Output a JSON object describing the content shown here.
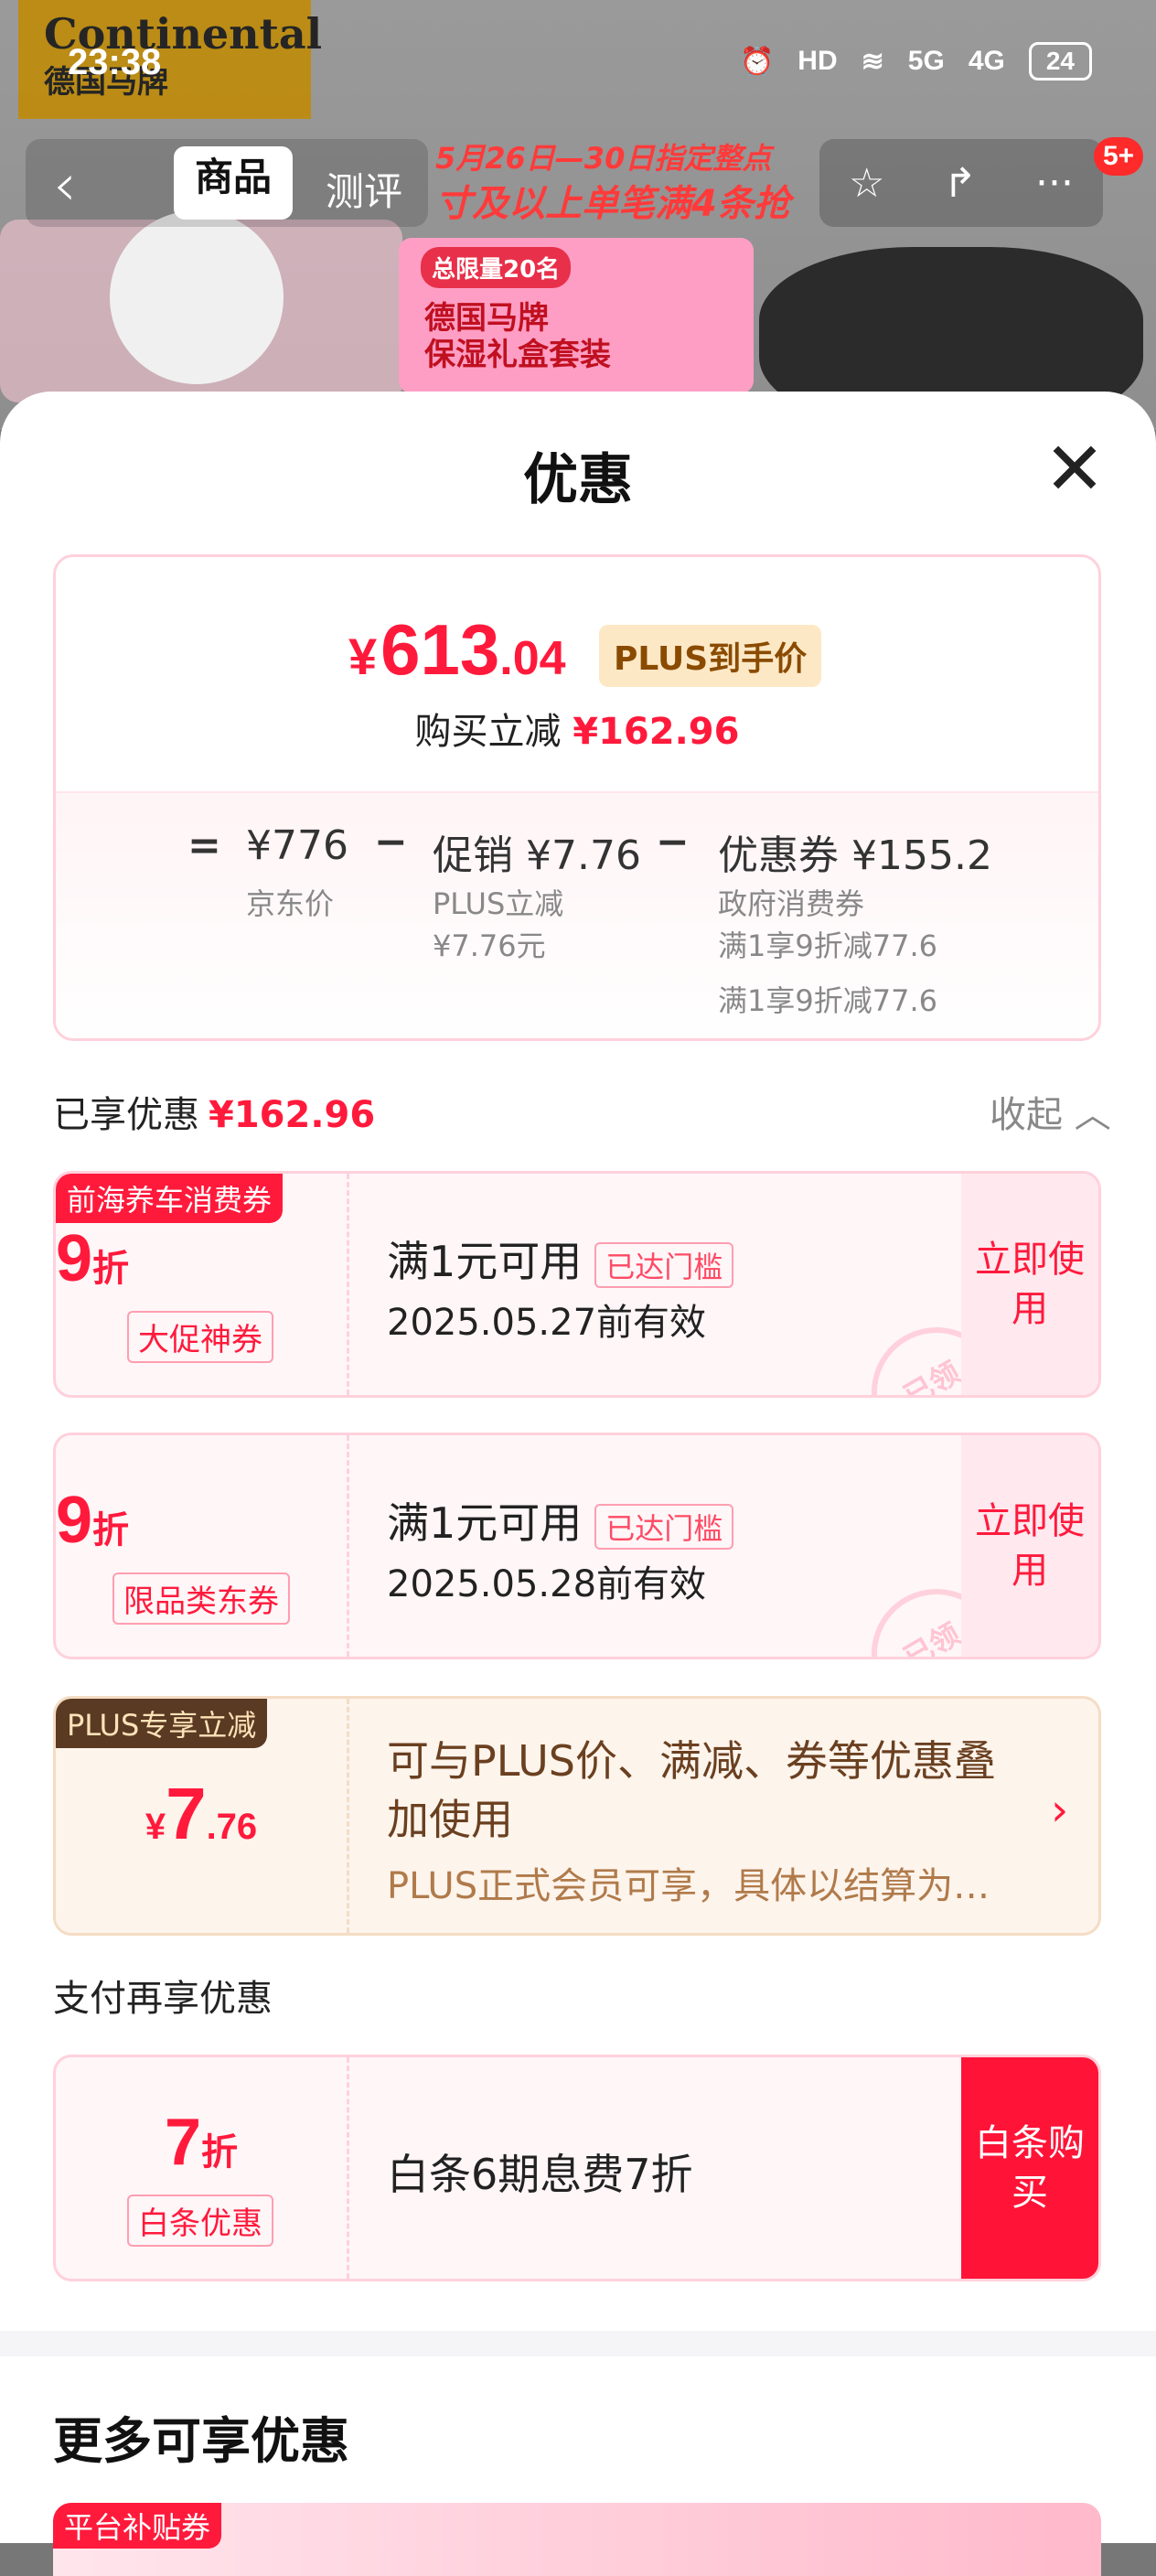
{
  "status_bar": {
    "time": "23:38",
    "icons": [
      "alarm-icon",
      "hd-icon",
      "wifi-icon",
      "5g-signal-icon",
      "4g-signal-icon"
    ],
    "hd": "HD",
    "net5g": "5G",
    "net4g": "4G",
    "battery": "24"
  },
  "background": {
    "brand": "Continental",
    "brand_cn": "德国马牌",
    "nav_tab_active": "商品",
    "nav_tab": "测评",
    "promo_line1": "5月26日—30日指定整点",
    "promo_line2": "寸及以上单笔满4条抢",
    "gift_tag": "总限量20名",
    "gift_line1": "德国马牌",
    "gift_line2": "保湿礼盒套装",
    "badge": "5+"
  },
  "sheet": {
    "title": "优惠",
    "close_label": "✕"
  },
  "price_card": {
    "yen": "¥",
    "price_int": "613",
    "price_dec": ".04",
    "plus_tag": "PLUS到手价",
    "save_prefix": "购买立减",
    "save_amount": "¥162.96",
    "eq": "=",
    "minus": "−",
    "jd_price": "¥776",
    "jd_price_label": "京东价",
    "promo": "促销 ¥7.76",
    "promo_sub1": "PLUS立减",
    "promo_sub2": "¥7.76元",
    "coupon": "优惠券 ¥155.2",
    "coupon_sub1": "政府消费券",
    "coupon_sub2": "满1享9折减77.6",
    "coupon_sub3": "满1享9折减77.6"
  },
  "enjoyed": {
    "label": "已享优惠",
    "amount": "¥162.96",
    "collapse": "收起 ︿"
  },
  "coupons": [
    {
      "corner": "前海养车消费券",
      "big": "9",
      "unit": "折",
      "pill": "大促神券",
      "cond": "满1元可用",
      "reached": "已达门槛",
      "valid": "2025.05.27前有效",
      "action": "立即使用",
      "stamp": "已领"
    },
    {
      "corner": "",
      "big": "9",
      "unit": "折",
      "pill": "限品类东券",
      "cond": "满1元可用",
      "reached": "已达门槛",
      "valid": "2025.05.28前有效",
      "action": "立即使用",
      "stamp": "已领"
    }
  ],
  "plus": {
    "corner": "PLUS专享立减",
    "yen": "¥",
    "int": "7",
    "dec": ".76",
    "line1": "可与PLUS价、满减、券等优惠叠加使用",
    "line2": "PLUS正式会员可享，具体以结算为…",
    "arrow": "›"
  },
  "pay": {
    "label": "支付再享优惠",
    "big": "7",
    "unit": "折",
    "pill": "白条优惠",
    "cond": "白条6期息费7折",
    "action": "白条购买"
  },
  "more": {
    "title": "更多可享优惠",
    "corner": "平台补贴券"
  }
}
